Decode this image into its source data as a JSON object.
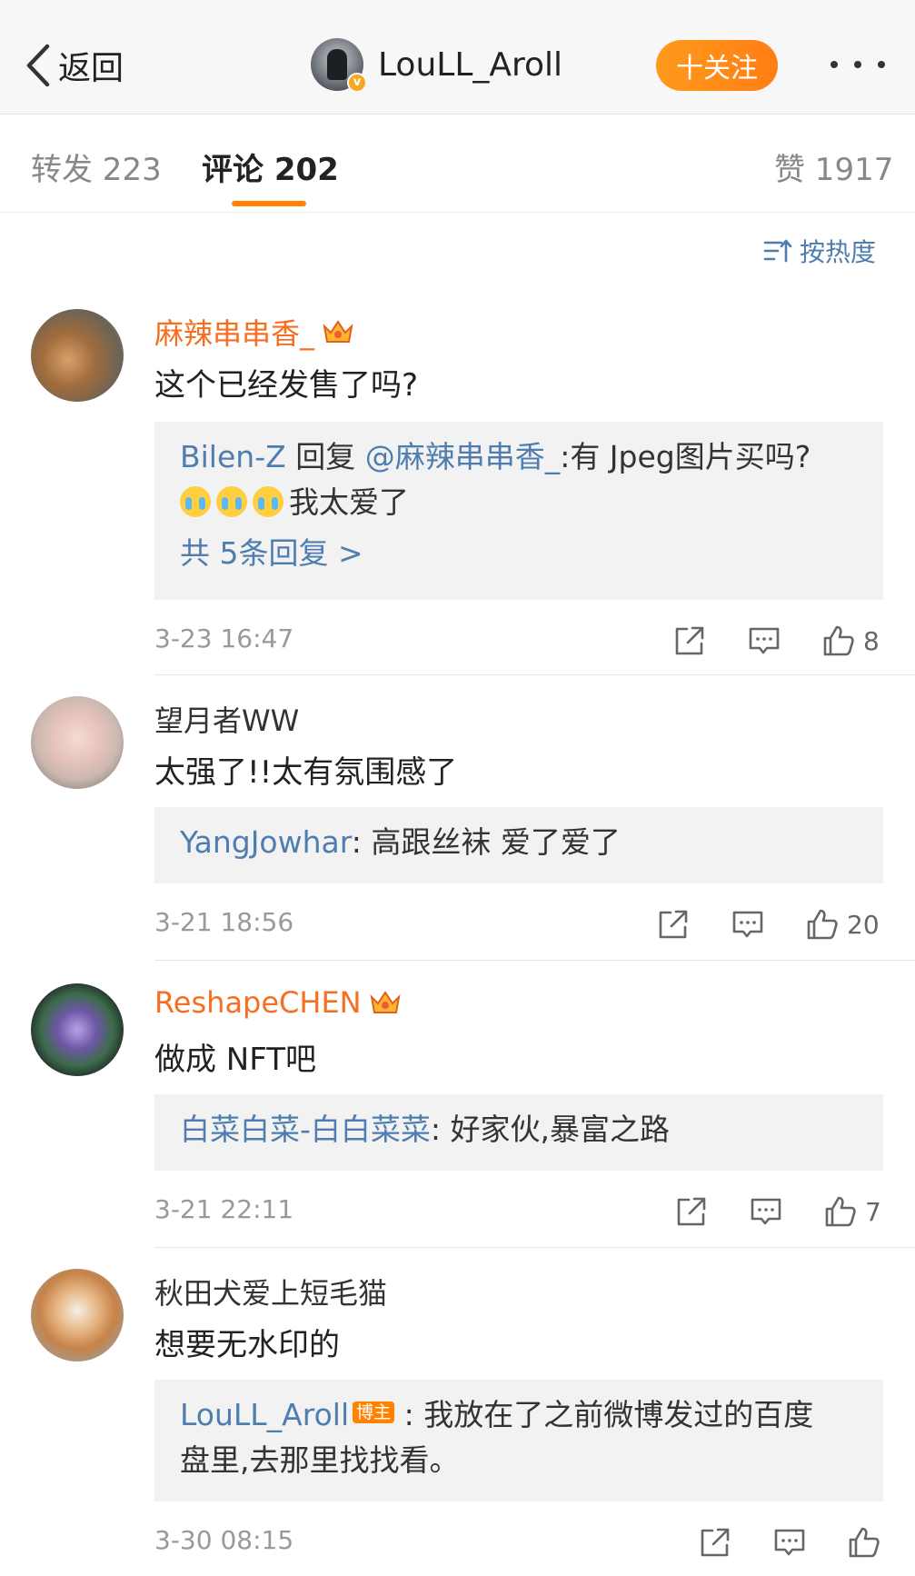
{
  "nav": {
    "back_label": "返回",
    "user_name": "LouLL_Aroll",
    "follow_label": "十关注"
  },
  "tabs": [
    {
      "label": "转发 223"
    },
    {
      "label": "评论 202"
    },
    {
      "label": "赞 1917"
    }
  ],
  "sort_label": "按热度",
  "comments": [
    {
      "author": "麻辣串串香_",
      "text": "这个已经发售了吗?",
      "reply_name": "Bilen-Z",
      "reply_text_1": " 回复 ",
      "reply_mention": "@麻辣串串香_",
      "reply_text_2": ":有 Jpeg图片买吗?",
      "reply_line2": "我太爱了",
      "reply_more": "共 5条回复 >",
      "time": "3-23 16:47",
      "likes": "8"
    },
    {
      "author": "望月者WW",
      "text": "太强了!!太有氛围感了",
      "reply_name": "YangJowhar",
      "reply_text": ": 高跟丝袜 爱了爱了",
      "time": "3-21 18:56",
      "likes": "20"
    },
    {
      "author": "ReshapeCHEN",
      "text": "做成 NFT吧",
      "reply_name": "白菜白菜-白白菜菜",
      "reply_text": ": 好家伙,暴富之路",
      "time": "3-21 22:11",
      "likes": "7"
    },
    {
      "author": "秋田犬爱上短毛猫",
      "text": "想要无水印的",
      "reply_name": "LouLL_Aroll",
      "reply_badge": "博主",
      "reply_text": " : 我放在了之前微博发过的百度",
      "reply_line2": "盘里,去那里找找看。",
      "time": "3-30 08:15",
      "likes": ""
    }
  ],
  "colors": {
    "accent": "#ff8200",
    "link_blue": "#507daf",
    "vip_orange": "#f86e21"
  }
}
